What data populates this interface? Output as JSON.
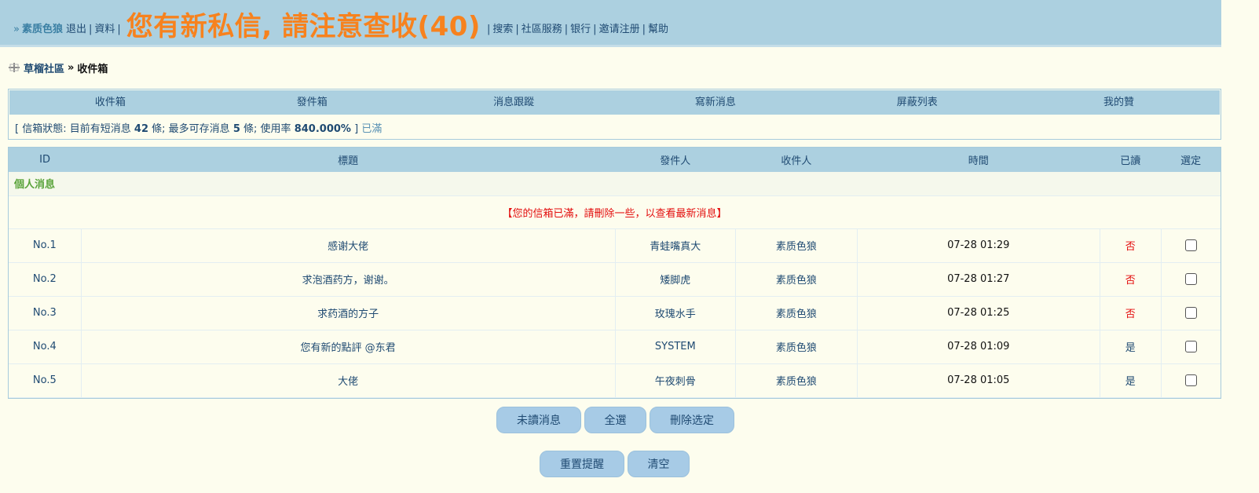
{
  "topbar": {
    "prefix": "»",
    "user": "素质色狼",
    "logout": "退出",
    "profile": "資料",
    "alert": "您有新私信, 請注意查收(40)",
    "search": "搜索",
    "community": "社區服務",
    "bank": "银行",
    "invite": "邀请注册",
    "help": "幫助",
    "separator": "|"
  },
  "breadcrumb": {
    "home": "草榴社區",
    "arrow": "»",
    "current": "收件箱"
  },
  "tabs": [
    {
      "label": "收件箱"
    },
    {
      "label": "發件箱"
    },
    {
      "label": "消息跟蹤"
    },
    {
      "label": "寫新消息"
    },
    {
      "label": "屏蔽列表"
    },
    {
      "label": "我的贊"
    }
  ],
  "status": {
    "open": "[",
    "label": "信箱狀態:",
    "text1": "目前有短消息",
    "count": "42",
    "unit1": "條;",
    "text2": "最多可存消息",
    "max": "5",
    "unit2": "條;",
    "text3": "使用率",
    "rate": "840.000%",
    "close": "]",
    "full": "已滿"
  },
  "table": {
    "headers": [
      "ID",
      "標題",
      "發件人",
      "收件人",
      "時間",
      "已讀",
      "選定"
    ],
    "section": "個人消息",
    "notice": "【您的信箱已滿，請刪除一些，以查看最新消息】",
    "rows": [
      {
        "id": "No.1",
        "title": "感谢大佬",
        "sender": "青蛙嘴真大",
        "receiver": "素质色狼",
        "time": "07-28 01:29",
        "read": "否"
      },
      {
        "id": "No.2",
        "title": "求泡酒药方，谢谢。",
        "sender": "矮脚虎",
        "receiver": "素质色狼",
        "time": "07-28 01:27",
        "read": "否"
      },
      {
        "id": "No.3",
        "title": "求药酒的方子",
        "sender": "玫瑰水手",
        "receiver": "素质色狼",
        "time": "07-28 01:25",
        "read": "否"
      },
      {
        "id": "No.4",
        "title": "您有新的點評 @东君",
        "sender": "SYSTEM",
        "receiver": "素质色狼",
        "time": "07-28 01:09",
        "read": "是"
      },
      {
        "id": "No.5",
        "title": "大佬",
        "sender": "午夜刺骨",
        "receiver": "素质色狼",
        "time": "07-28 01:05",
        "read": "是"
      }
    ]
  },
  "buttons": {
    "unread": "未讀消息",
    "select_all": "全選",
    "delete_selected": "刪除选定",
    "reset_alert": "重置提醒",
    "clear": "清空"
  },
  "colors": {
    "header_bg": "#acd0e0",
    "alert": "#f7821e",
    "unread": "#e30d0d",
    "section": "#59a33a",
    "page_bg": "#fdfdee"
  }
}
